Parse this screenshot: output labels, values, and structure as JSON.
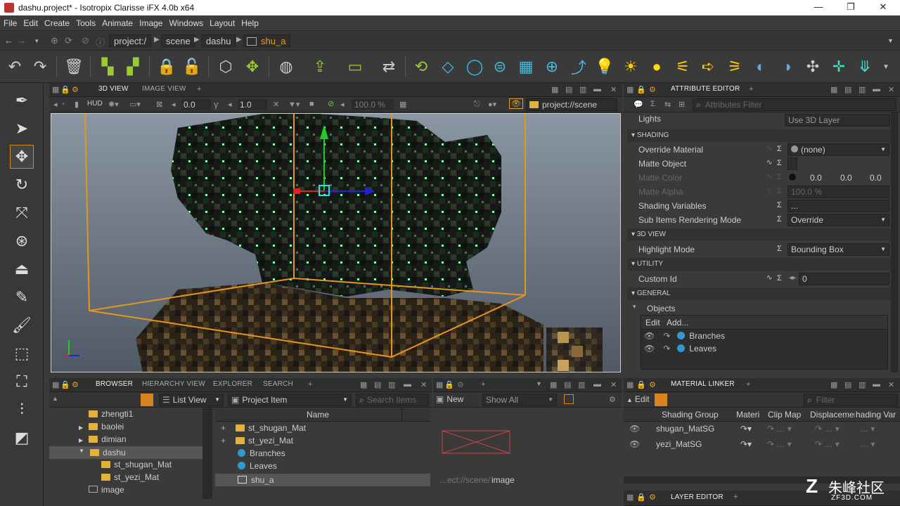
{
  "window": {
    "title": "dashu.project* - Isotropix Clarisse iFX 4.0b x64"
  },
  "menu": [
    "File",
    "Edit",
    "Create",
    "Tools",
    "Animate",
    "Image",
    "Windows",
    "Layout",
    "Help"
  ],
  "path": {
    "crumbs": [
      "project:/",
      "scene",
      "dashu"
    ],
    "current": "shu_a"
  },
  "viewport_panel": {
    "tabs": [
      "3D VIEW",
      "IMAGE VIEW"
    ],
    "hud": "HUD",
    "val1": "0.0",
    "val2": "1.0",
    "percent": "100.0 %",
    "scene_path": "project://scene"
  },
  "attribute_editor": {
    "tab": "ATTRIBUTE EDITOR",
    "filter_placeholder": "Attributes Filter",
    "top_row": {
      "label": "Lights",
      "value": "Use 3D Layer"
    },
    "sections": {
      "shading": "SHADING",
      "view3d": "3D VIEW",
      "utility": "UTILITY",
      "general": "GENERAL"
    },
    "override_material": {
      "label": "Override Material",
      "value": "(none)"
    },
    "matte_object": {
      "label": "Matte Object"
    },
    "matte_color": {
      "label": "Matte Color",
      "r": "0.0",
      "g": "0.0",
      "b": "0.0"
    },
    "matte_alpha": {
      "label": "Matte Alpha",
      "value": "100.0 %"
    },
    "shading_variables": {
      "label": "Shading Variables",
      "value": "..."
    },
    "sub_items": {
      "label": "Sub Items Rendering Mode",
      "value": "Override"
    },
    "highlight_mode": {
      "label": "Highlight Mode",
      "value": "Bounding Box"
    },
    "custom_id": {
      "label": "Custom Id",
      "value": "0"
    },
    "objects": {
      "label": "Objects",
      "edit": "Edit",
      "add": "Add...",
      "items": [
        "Branches",
        "Leaves"
      ]
    }
  },
  "browser": {
    "tabs": [
      "BROWSER",
      "HIERARCHY VIEW",
      "EXPLORER",
      "SEARCH"
    ],
    "view_mode": "List View",
    "item_type": "Project Item",
    "search_placeholder": "Search Items",
    "tree": [
      "zhengti1",
      "baolei",
      "dimian",
      "dashu",
      "st_shugan_Mat",
      "st_yezi_Mat",
      "image"
    ],
    "column_name": "Name",
    "items": [
      "st_shugan_Mat",
      "st_yezi_Mat",
      "Branches",
      "Leaves",
      "shu_a"
    ]
  },
  "image_panel": {
    "new": "New",
    "show": "Show All",
    "path_prefix": "...ect://scene/",
    "path_name": "image"
  },
  "material_linker": {
    "tab": "MATERIAL LINKER",
    "edit": "Edit",
    "filter_placeholder": "Filter",
    "columns": [
      "Shading Group",
      "Materi",
      "Clip Map",
      "Displacement",
      "hading Var"
    ],
    "rows": [
      "shugan_MatSG",
      "yezi_MatSG"
    ]
  },
  "layer_editor": {
    "tab": "LAYER EDITOR"
  },
  "watermark": {
    "text": "朱峰社区",
    "sub": "ZF3D.COM"
  }
}
